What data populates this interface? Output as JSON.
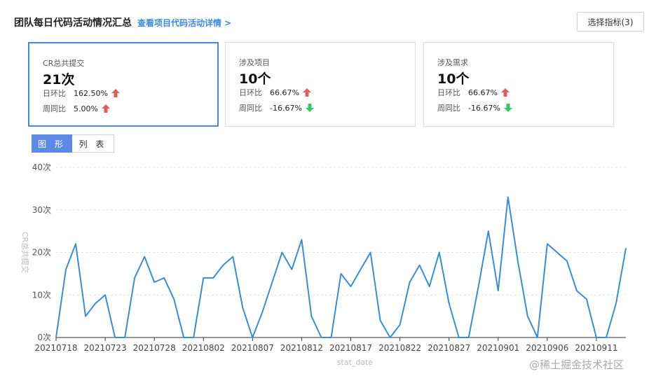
{
  "header": {
    "title": "团队每日代码活动情况汇总",
    "detail_link": "查看项目代码活动详情 >"
  },
  "select_button": "选择指标(3)",
  "cards": [
    {
      "label": "CR总共提交",
      "value": "21次",
      "rows": [
        {
          "key": "日环比",
          "val": "162.50%",
          "dir": "up"
        },
        {
          "key": "周同比",
          "val": "5.00%",
          "dir": "up"
        }
      ]
    },
    {
      "label": "涉及项目",
      "value": "10个",
      "rows": [
        {
          "key": "日环比",
          "val": "66.67%",
          "dir": "up"
        },
        {
          "key": "周同比",
          "val": "-16.67%",
          "dir": "down"
        }
      ]
    },
    {
      "label": "涉及需求",
      "value": "10个",
      "rows": [
        {
          "key": "日环比",
          "val": "66.67%",
          "dir": "up"
        },
        {
          "key": "周同比",
          "val": "-16.67%",
          "dir": "down"
        }
      ]
    }
  ],
  "tabs": [
    "图 形",
    "列 表"
  ],
  "colors": {
    "up": "#e05d5d",
    "down": "#3cc46a",
    "line": "#3c8dd0",
    "active_border": "#4a86d6",
    "tab_active": "#5e89e6"
  },
  "watermark": "@稀土掘金技术社区",
  "chart_data": {
    "type": "line",
    "xlabel": "stat_date",
    "ylabel": "CR总共提交",
    "ylim": [
      0,
      40
    ],
    "yticks": [
      "0次",
      "10次",
      "20次",
      "30次",
      "40次"
    ],
    "grid": true,
    "x_tick_labels": [
      "20210718",
      "20210723",
      "20210728",
      "20210802",
      "20210807",
      "20210812",
      "20210817",
      "20210822",
      "20210827",
      "20210901",
      "20210906",
      "20210911"
    ],
    "x": [
      "20210718",
      "20210719",
      "20210720",
      "20210721",
      "20210722",
      "20210723",
      "20210724",
      "20210725",
      "20210726",
      "20210727",
      "20210728",
      "20210729",
      "20210730",
      "20210731",
      "20210801",
      "20210802",
      "20210803",
      "20210804",
      "20210805",
      "20210806",
      "20210807",
      "20210808",
      "20210809",
      "20210810",
      "20210811",
      "20210812",
      "20210813",
      "20210814",
      "20210815",
      "20210816",
      "20210817",
      "20210818",
      "20210819",
      "20210820",
      "20210821",
      "20210822",
      "20210823",
      "20210824",
      "20210825",
      "20210826",
      "20210827",
      "20210828",
      "20210829",
      "20210830",
      "20210831",
      "20210901",
      "20210902",
      "20210903",
      "20210904",
      "20210905",
      "20210906",
      "20210907",
      "20210908",
      "20210909",
      "20210910",
      "20210911",
      "20210912",
      "20210913",
      "20210914"
    ],
    "series": [
      {
        "values": [
          0,
          16,
          22,
          5,
          8,
          10,
          0,
          0,
          14,
          19,
          13,
          14,
          9,
          0,
          0,
          14,
          14,
          17,
          19,
          7,
          0,
          6,
          13,
          20,
          16,
          23,
          5,
          0,
          0,
          15,
          12,
          16,
          20,
          4,
          0,
          3,
          13,
          17,
          12,
          20,
          8,
          0,
          0,
          12,
          25,
          11,
          33,
          18,
          5,
          0,
          22,
          20,
          18,
          11,
          9,
          0,
          0,
          8,
          21
        ]
      }
    ]
  }
}
